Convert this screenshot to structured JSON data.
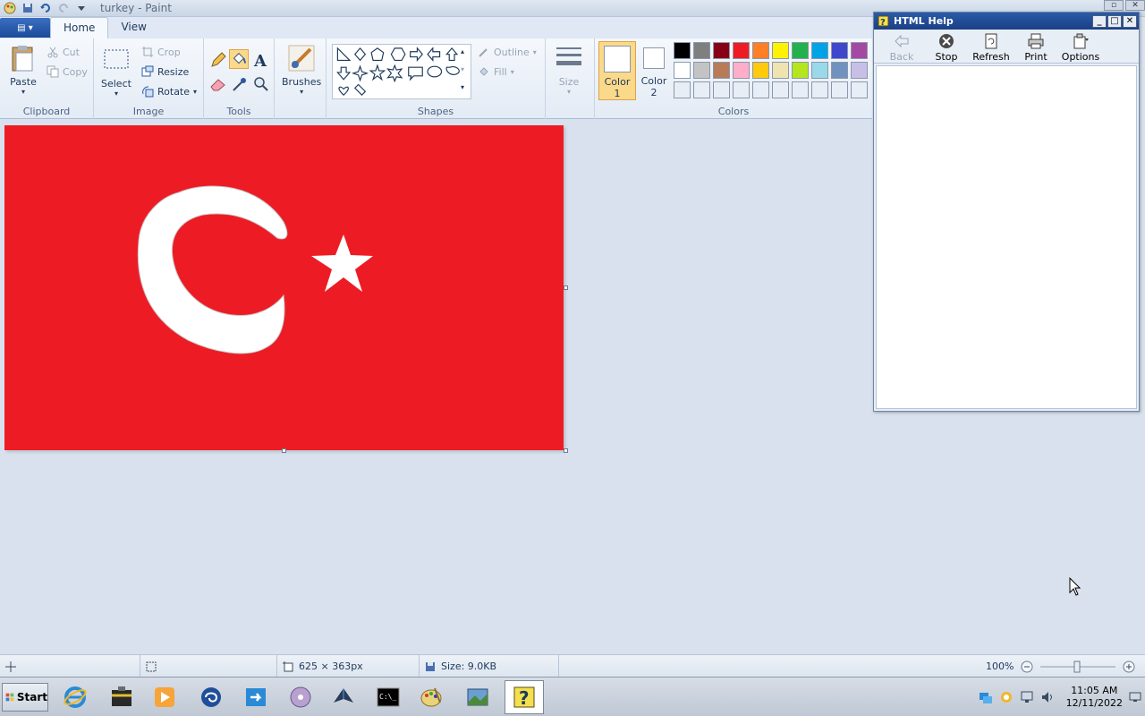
{
  "window": {
    "title": "turkey - Paint"
  },
  "tabs": [
    {
      "label": "Home"
    },
    {
      "label": "View"
    }
  ],
  "ribbon": {
    "clipboard": {
      "label": "Clipboard",
      "paste": "Paste",
      "cut": "Cut",
      "copy": "Copy"
    },
    "image": {
      "label": "Image",
      "select": "Select",
      "crop": "Crop",
      "resize": "Resize",
      "rotate": "Rotate"
    },
    "tools": {
      "label": "Tools"
    },
    "brushes": {
      "label": "Brushes"
    },
    "shapes": {
      "label": "Shapes",
      "outline": "Outline",
      "fill": "Fill"
    },
    "size": {
      "label": "Size"
    },
    "colors": {
      "label": "Colors",
      "color1": "Color",
      "color1_num": "1",
      "color2": "Color",
      "color2_num": "2",
      "palette": [
        "#000000",
        "#7f7f7f",
        "#880015",
        "#ed1c24",
        "#ff7f27",
        "#fff200",
        "#22b14c",
        "#00a2e8",
        "#3f48cc",
        "#a349a4",
        "#ffffff",
        "#c3c3c3",
        "#b97a57",
        "#ffaec9",
        "#ffc90e",
        "#efe4b0",
        "#b5e61d",
        "#99d9ea",
        "#7092be",
        "#c8bfe7",
        "#e8eef6",
        "#e8eef6",
        "#e8eef6",
        "#e8eef6",
        "#e8eef6",
        "#e8eef6",
        "#e8eef6",
        "#e8eef6",
        "#e8eef6",
        "#e8eef6"
      ]
    }
  },
  "canvas": {
    "background": "#ed1c24",
    "symbol": "#ffffff"
  },
  "help_window": {
    "title": "HTML Help",
    "toolbar": [
      {
        "label": "Back"
      },
      {
        "label": "Stop"
      },
      {
        "label": "Refresh"
      },
      {
        "label": "Print"
      },
      {
        "label": "Options"
      }
    ]
  },
  "statusbar": {
    "dimensions": "625 × 363px",
    "size": "Size: 9.0KB",
    "zoom": "100%"
  },
  "taskbar": {
    "start": "Start",
    "clock_time": "11:05 AM",
    "clock_date": "12/11/2022"
  }
}
